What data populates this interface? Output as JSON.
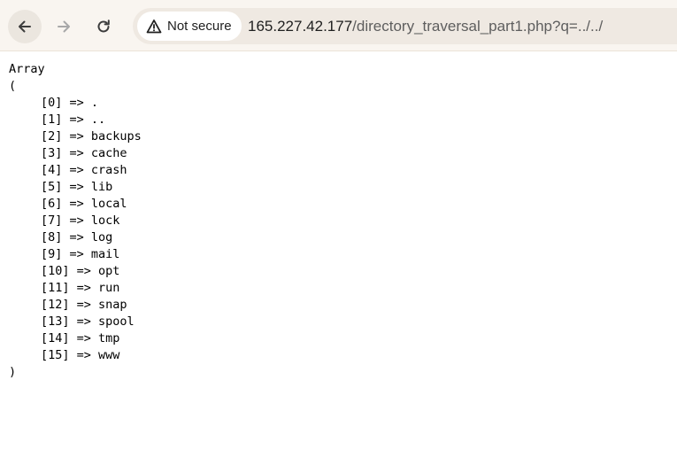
{
  "browser": {
    "security_label": "Not secure",
    "url_host": "165.227.42.177",
    "url_path": "/directory_traversal_part1.php?q=../../"
  },
  "page": {
    "open_line": "Array",
    "open_paren": "(",
    "close_paren": ")",
    "entries": [
      {
        "key": "[0] => .",
        "value": ""
      },
      {
        "key": "[1] => ..",
        "value": ""
      },
      {
        "key": "[2] => backups",
        "value": ""
      },
      {
        "key": "[3] => cache",
        "value": ""
      },
      {
        "key": "[4] => crash",
        "value": ""
      },
      {
        "key": "[5] => lib",
        "value": ""
      },
      {
        "key": "[6] => local",
        "value": ""
      },
      {
        "key": "[7] => lock",
        "value": ""
      },
      {
        "key": "[8] => log",
        "value": ""
      },
      {
        "key": "[9] => mail",
        "value": ""
      },
      {
        "key": "[10] => opt",
        "value": ""
      },
      {
        "key": "[11] => run",
        "value": ""
      },
      {
        "key": "[12] => snap",
        "value": ""
      },
      {
        "key": "[13] => spool",
        "value": ""
      },
      {
        "key": "[14] => tmp",
        "value": ""
      },
      {
        "key": "[15] => www",
        "value": ""
      }
    ]
  },
  "icons": {
    "back": "arrow-left-icon",
    "forward": "arrow-right-icon",
    "reload": "reload-icon",
    "security": "warning-triangle-icon"
  }
}
